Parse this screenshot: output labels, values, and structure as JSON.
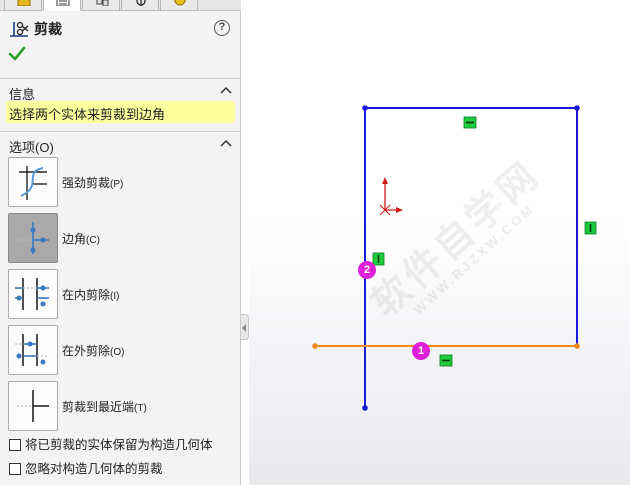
{
  "property_manager": {
    "title": "剪裁",
    "help_label": "?",
    "tabs": [
      {
        "icon": "feature-manager-icon"
      },
      {
        "icon": "property-manager-icon"
      },
      {
        "icon": "configuration-manager-icon"
      },
      {
        "icon": "dimxpert-manager-icon"
      },
      {
        "icon": "display-manager-icon"
      }
    ],
    "message_section": {
      "title": "信息",
      "message": "选择两个实体来剪裁到边角"
    },
    "options_section": {
      "title": "选项(O)",
      "options": [
        {
          "label": "强劲剪裁",
          "key": "(P)",
          "icon": "power-trim-icon",
          "selected": false
        },
        {
          "label": "边角",
          "key": "(C)",
          "icon": "corner-trim-icon",
          "selected": true
        },
        {
          "label": "在内剪除",
          "key": "(I)",
          "icon": "trim-away-inside-icon",
          "selected": false
        },
        {
          "label": "在外剪除",
          "key": "(O)",
          "icon": "trim-away-outside-icon",
          "selected": false
        },
        {
          "label": "剪裁到最近端",
          "key": "(T)",
          "icon": "trim-to-closest-icon",
          "selected": false
        }
      ],
      "checkboxes": [
        {
          "label": "将已剪裁的实体保留为构造几何体",
          "checked": false
        },
        {
          "label": "忽略对构造几何体的剪裁",
          "checked": false
        }
      ]
    }
  },
  "canvas": {
    "watermark": "软件自学网",
    "watermark_sub": "WWW.RJZXW.COM",
    "selection_badges": [
      "1",
      "2"
    ],
    "colors": {
      "sketch_line": "#1a1adc",
      "selected_line": "#f28a1c",
      "relation_icon": "#1ecb3c",
      "badge": "#e020d8",
      "origin_arrow": "#d21a1a",
      "message_highlight": "#ffff9f"
    }
  }
}
